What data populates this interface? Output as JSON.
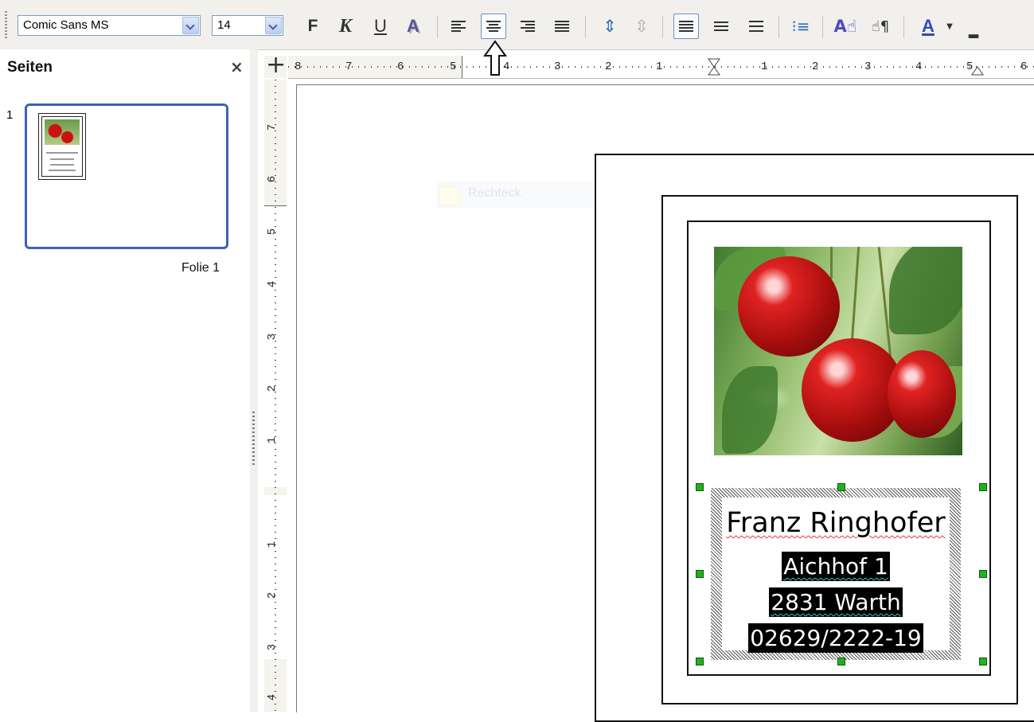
{
  "toolbar": {
    "font_name": "Comic Sans MS",
    "font_size": "14",
    "bold_label": "F",
    "italic_label": "K",
    "underline_label": "U",
    "shadow_label": "A",
    "font_color_label": "A"
  },
  "side_panel": {
    "title": "Seiten",
    "close": "×",
    "slide_number": "1",
    "slide_label": "Folie 1"
  },
  "ruler": {
    "h_labels": [
      "8",
      "7",
      "6",
      "5",
      "4",
      "3",
      "2",
      "1",
      "1",
      "2",
      "3",
      "4",
      "5",
      "6"
    ],
    "v_labels": [
      "7",
      "6",
      "5",
      "4",
      "3",
      "2",
      "1",
      "1",
      "2",
      "3",
      "4"
    ]
  },
  "canvas": {
    "ghost_tooltip": "Rechteck"
  },
  "card": {
    "name": "Franz Ringhofer",
    "street": "Aichhof 1",
    "city": "2831 Warth",
    "phone": "02629/2222-19"
  },
  "colors": {
    "selection_border": "#3c64b2",
    "handle_green": "#22b022",
    "toolbar_bg": "#f1f0ec"
  }
}
